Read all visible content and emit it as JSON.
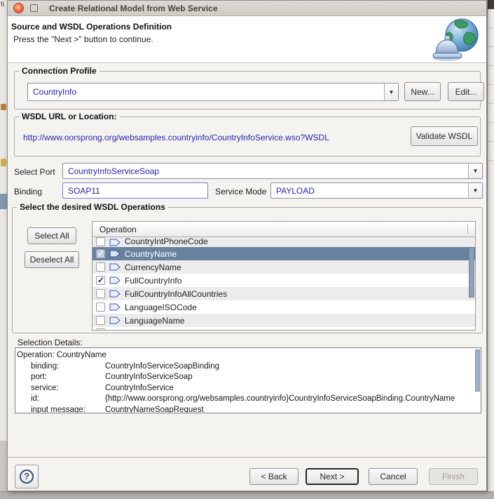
{
  "window": {
    "title": "Create Relational Model from Web Service"
  },
  "header": {
    "title": "Source and WSDL Operations Definition",
    "subtitle": "Press the \"Next >\" button to continue."
  },
  "connection_profile": {
    "legend": "Connection Profile",
    "value": "CountryInfo",
    "new_label": "New...",
    "edit_label": "Edit..."
  },
  "wsdl": {
    "legend": "WSDL URL or Location:",
    "url": "http://www.oorsprong.org/websamples.countryinfo/CountryInfoService.wso?WSDL",
    "validate_label": "Validate WSDL"
  },
  "port_row": {
    "label": "Select Port",
    "value": "CountryInfoServiceSoap"
  },
  "binding_row": {
    "label": "Binding",
    "value": "SOAP11"
  },
  "service_mode": {
    "label": "Service Mode",
    "value": "PAYLOAD"
  },
  "operations": {
    "legend": "Select the desired WSDL Operations",
    "select_all": "Select All",
    "deselect_all": "Deselect All",
    "column_header": "Operation",
    "rows": [
      {
        "label": "CountryIntPhoneCode",
        "checked": false,
        "selected": false
      },
      {
        "label": "CountryName",
        "checked": true,
        "selected": true
      },
      {
        "label": "CurrencyName",
        "checked": false,
        "selected": false
      },
      {
        "label": "FullCountryInfo",
        "checked": true,
        "selected": false
      },
      {
        "label": "FullCountryInfoAllCountries",
        "checked": false,
        "selected": false
      },
      {
        "label": "LanguageISOCode",
        "checked": false,
        "selected": false
      },
      {
        "label": "LanguageName",
        "checked": false,
        "selected": false
      }
    ]
  },
  "details": {
    "label": "Selection Details:",
    "lines": [
      {
        "label": "Operation: CountryName",
        "value": ""
      },
      {
        "label": "binding:",
        "value": "CountryInfoServiceSoapBinding"
      },
      {
        "label": "port:",
        "value": "CountryInfoServiceSoap"
      },
      {
        "label": "service:",
        "value": "CountryInfoService"
      },
      {
        "label": "id:",
        "value": "{http://www.oorsprong.org/websamples.countryinfo}CountryInfoServiceSoapBinding.CountryName"
      },
      {
        "label": "input message:",
        "value": "CountryNameSoapRequest"
      }
    ]
  },
  "footer": {
    "help": "?",
    "back": "< Back",
    "next": "Next >",
    "cancel": "Cancel",
    "finish": "Finish"
  },
  "colors": {
    "value_text": "#2525b2",
    "selected_row": "#69839f",
    "close_button": "#e8602f",
    "dialog_background": "#f4f3f0"
  }
}
